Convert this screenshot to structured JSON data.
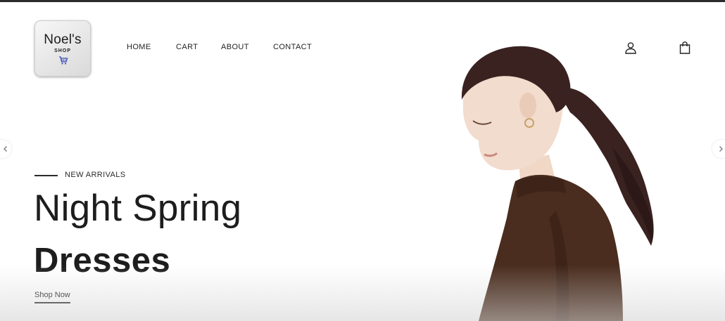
{
  "brand": {
    "name": "Noel's",
    "sub": "SHOP"
  },
  "nav": {
    "items": [
      {
        "label": "HOME"
      },
      {
        "label": "CART"
      },
      {
        "label": "ABOUT"
      },
      {
        "label": "CONTACT"
      }
    ]
  },
  "header_icons": {
    "account": "user-icon",
    "bag": "shopping-bag-icon"
  },
  "carousel": {
    "prev_icon": "chevron-left-icon",
    "next_icon": "chevron-right-icon"
  },
  "hero": {
    "kicker": "NEW ARRIVALS",
    "headline_light": "Night Spring",
    "headline_bold": "Dresses",
    "cta_label": "Shop Now",
    "image_subject": "model-photo"
  },
  "colors": {
    "text": "#1d1d1d",
    "background": "#ffffff",
    "sweater_brown": "#4a2d1e",
    "hair": "#3a2220"
  }
}
